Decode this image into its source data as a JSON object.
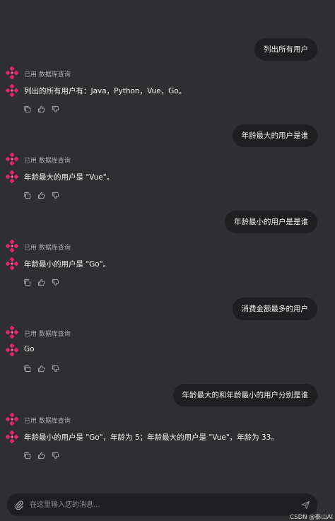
{
  "messages": [
    {
      "user": "列出所有用户",
      "tool": "已用 数据库查询",
      "answer": "列出的所有用户有：Java，Python，Vue，Go。"
    },
    {
      "user": "年龄最大的用户是谁",
      "tool": "已用 数据库查询",
      "answer": "年龄最大的用户是 \"Vue\"。"
    },
    {
      "user": "年龄最小的用户是是谁",
      "tool": "已用 数据库查询",
      "answer": "年龄最小的用户是 \"Go\"。"
    },
    {
      "user": "消费金额最多的用户",
      "tool": "已用 数据库查询",
      "answer": "Go"
    },
    {
      "user": "年龄最大的和年龄最小的用户分别是谁",
      "tool": "已用 数据库查询",
      "answer": "年龄最小的用户是 \"Go\"，年龄为 5；年龄最大的用户是 \"Vue\"，年龄为 33。"
    }
  ],
  "input": {
    "placeholder": "在这里输入您的消息..."
  },
  "watermark": "CSDN @泰山AI",
  "colors": {
    "accent": "#e8226b",
    "background": "#2f2f31",
    "bubble": "#1f1f21"
  },
  "icons": {
    "logo": "ai-logo-icon",
    "copy": "copy-icon",
    "like": "thumbs-up-icon",
    "dislike": "thumbs-down-icon",
    "attach": "paperclip-icon",
    "send": "send-icon"
  }
}
